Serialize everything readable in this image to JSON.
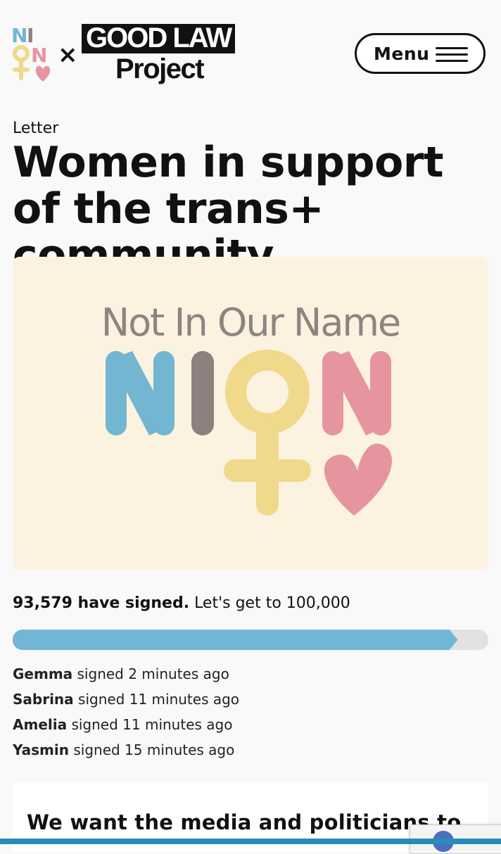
{
  "header": {
    "partner_separator": "×",
    "partner_logo_top": "GOOD LAW",
    "partner_logo_bottom": "Project",
    "menu_label": "Menu",
    "brand_logo_letters": "NION"
  },
  "page": {
    "eyebrow": "Letter",
    "title": "Women in support of the trans+ community"
  },
  "hero": {
    "tagline": "Not In Our Name",
    "logo_letters": [
      "N",
      "I",
      "O",
      "N"
    ],
    "logo_colors": {
      "blue": "#72b6d2",
      "grey": "#8c817e",
      "yellow": "#f0d98a",
      "pink": "#e6959f",
      "background": "#fbf3e0"
    }
  },
  "signatures": {
    "count_bold": "93,579 have signed.",
    "goal_text": "Let's get to 100,000",
    "progress_fraction": 0.93579,
    "recent": [
      {
        "name": "Gemma",
        "time": "signed 2 minutes ago"
      },
      {
        "name": "Sabrina",
        "time": "signed 11 minutes ago"
      },
      {
        "name": "Amelia",
        "time": "signed 11 minutes ago"
      },
      {
        "name": "Yasmin",
        "time": "signed 15 minutes ago"
      }
    ]
  },
  "card": {
    "text": "We want the media and politicians to"
  },
  "colors": {
    "accent_blue": "#71b6d4",
    "progress_track": "#e2e2e2",
    "page_background": "#f9f9f9"
  }
}
